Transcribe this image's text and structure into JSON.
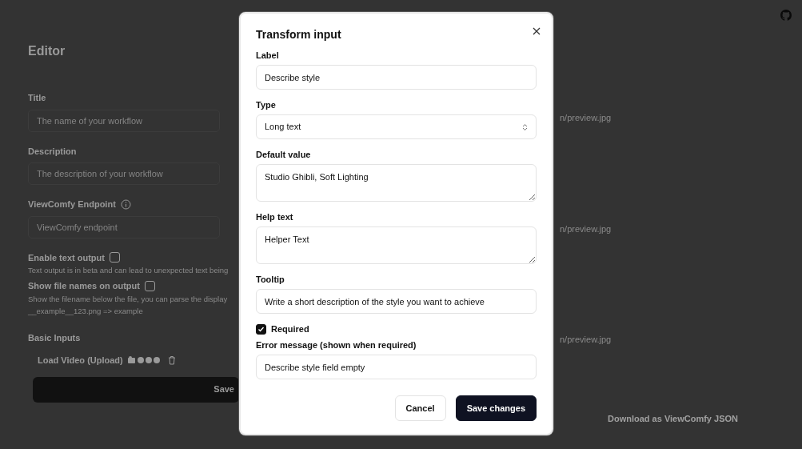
{
  "editor": {
    "heading": "Editor",
    "fields": [
      {
        "label": "Title",
        "placeholder": "The name of your workflow",
        "info": false
      },
      {
        "label": "Description",
        "placeholder": "The description of your workflow",
        "info": false
      },
      {
        "label": "ViewComfy Endpoint",
        "placeholder": "ViewComfy endpoint",
        "info": true
      }
    ],
    "options": [
      {
        "label": "Enable text output",
        "checked": false,
        "help": [
          "Text output is in beta and can lead to unexpected text being"
        ]
      },
      {
        "label": "Show file names on output",
        "checked": false,
        "help": [
          "Show the filename below the file, you can parse the display",
          "__example__123.png => example"
        ]
      }
    ],
    "section": "Basic Inputs",
    "inputs": [
      {
        "name": "Load Video (Upload)"
      }
    ],
    "save_button": "Save"
  },
  "preview_fields": [
    "n/preview.jpg",
    "n/preview.jpg",
    "n/preview.jpg"
  ],
  "download_button": "Download as ViewComfy JSON",
  "dialog": {
    "title": "Transform input",
    "fields": [
      {
        "kind": "input",
        "label": "Label",
        "value": "Describe style"
      },
      {
        "kind": "select",
        "label": "Type",
        "value": "Long text"
      },
      {
        "kind": "textarea",
        "label": "Default value",
        "value": "Studio Ghibli, Soft Lighting"
      },
      {
        "kind": "textarea",
        "label": "Help text",
        "value": "Helper Text"
      },
      {
        "kind": "input",
        "label": "Tooltip",
        "value": "Write a short description of the style you want to achieve"
      },
      {
        "kind": "checkbox",
        "label": "Required",
        "checked": true
      },
      {
        "kind": "input",
        "label": "Error message (shown when required)",
        "value": "Describe style field empty"
      }
    ],
    "buttons": [
      {
        "label": "Cancel",
        "primary": false
      },
      {
        "label": "Save changes",
        "primary": true
      }
    ]
  }
}
